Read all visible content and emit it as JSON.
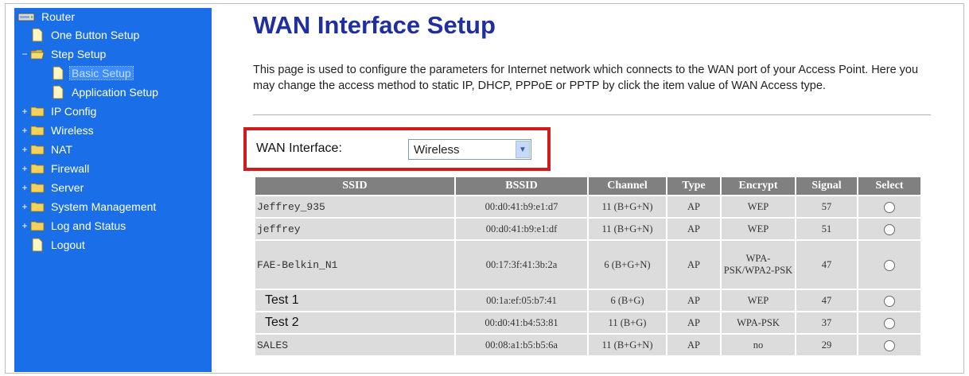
{
  "sidebar": {
    "items": [
      {
        "label": "Router",
        "icon": "router-icon",
        "level": 0,
        "expander": "",
        "selected": false
      },
      {
        "label": "One Button Setup",
        "icon": "page-icon",
        "level": 1,
        "expander": "",
        "selected": false
      },
      {
        "label": "Step Setup",
        "icon": "folder-open-icon",
        "level": 1,
        "expander": "−",
        "selected": false
      },
      {
        "label": "Basic Setup",
        "icon": "page-icon",
        "level": 2,
        "expander": "",
        "selected": true
      },
      {
        "label": "Application Setup",
        "icon": "page-icon",
        "level": 2,
        "expander": "",
        "selected": false
      },
      {
        "label": "IP Config",
        "icon": "folder-icon",
        "level": 1,
        "expander": "+",
        "selected": false
      },
      {
        "label": "Wireless",
        "icon": "folder-icon",
        "level": 1,
        "expander": "+",
        "selected": false
      },
      {
        "label": "NAT",
        "icon": "folder-icon",
        "level": 1,
        "expander": "+",
        "selected": false
      },
      {
        "label": "Firewall",
        "icon": "folder-icon",
        "level": 1,
        "expander": "+",
        "selected": false
      },
      {
        "label": "Server",
        "icon": "folder-icon",
        "level": 1,
        "expander": "+",
        "selected": false
      },
      {
        "label": "System Management",
        "icon": "folder-icon",
        "level": 1,
        "expander": "+",
        "selected": false
      },
      {
        "label": "Log and Status",
        "icon": "folder-icon",
        "level": 1,
        "expander": "+",
        "selected": false
      },
      {
        "label": "Logout",
        "icon": "page-icon",
        "level": 1,
        "expander": "",
        "selected": false
      }
    ]
  },
  "main": {
    "title": "WAN Interface Setup",
    "description": "This page is used to configure the parameters for Internet network which connects to the WAN port of your Access Point. Here you may change the access method to static IP, DHCP, PPPoE or PPTP by click the item value of WAN Access type.",
    "wan_interface": {
      "label": "WAN Interface:",
      "value": "Wireless"
    },
    "table": {
      "headers": [
        "SSID",
        "BSSID",
        "Channel",
        "Type",
        "Encrypt",
        "Signal",
        "Select"
      ],
      "rows": [
        {
          "ssid": "Jeffrey_935",
          "bssid": "00:d0:41:b9:e1:d7",
          "channel": "11 (B+G+N)",
          "type": "AP",
          "encrypt": "WEP",
          "signal": "57"
        },
        {
          "ssid": "jeffrey",
          "bssid": "00:d0:41:b9:e1:df",
          "channel": "11 (B+G+N)",
          "type": "AP",
          "encrypt": "WEP",
          "signal": "51"
        },
        {
          "ssid": "FAE-Belkin_N1",
          "bssid": "00:17:3f:41:3b:2a",
          "channel": "6 (B+G+N)",
          "type": "AP",
          "encrypt": "WPA-PSK/WPA2-PSK",
          "signal": "47"
        },
        {
          "ssid": "Test 1",
          "bssid": "00:1a:ef:05:b7:41",
          "channel": "6 (B+G)",
          "type": "AP",
          "encrypt": "WEP",
          "signal": "47"
        },
        {
          "ssid": "Test 2",
          "bssid": "00:d0:41:b4:53:81",
          "channel": "11 (B+G)",
          "type": "AP",
          "encrypt": "WPA-PSK",
          "signal": "37"
        },
        {
          "ssid": "SALES",
          "bssid": "00:08:a1:b5:b5:6a",
          "channel": "11 (B+G+N)",
          "type": "AP",
          "encrypt": "no",
          "signal": "29"
        }
      ]
    }
  },
  "colors": {
    "sidebar_bg": "#1a6fe8",
    "title": "#1f2ea0",
    "highlight_border": "#d01c1c",
    "table_header_bg": "#808080",
    "table_cell_bg": "#dcdcdc"
  }
}
